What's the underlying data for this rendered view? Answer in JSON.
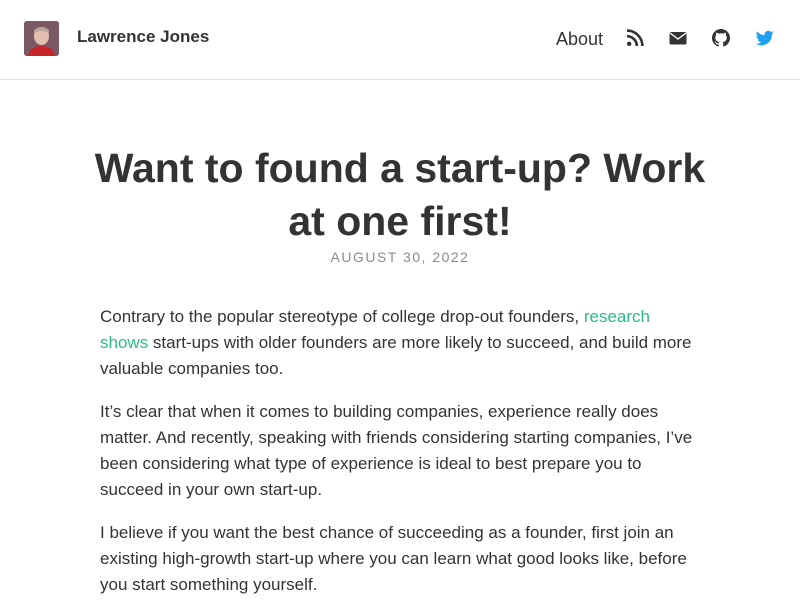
{
  "header": {
    "site_title": "Lawrence Jones",
    "nav": {
      "about_label": "About",
      "icons": [
        "rss-icon",
        "envelope-icon",
        "github-icon",
        "twitter-icon"
      ]
    }
  },
  "post": {
    "title": "Want to found a start-up? Work at one first!",
    "date": "AUGUST 30, 2022",
    "paragraphs": [
      {
        "before_link": "Contrary to the popular stereotype of college drop-out founders, ",
        "link_text": "research shows",
        "after_link": " start-ups with older founders are more likely to succeed, and build more valuable companies too."
      },
      {
        "text": "It’s clear that when it comes to building companies, experience really does matter. And recently, speaking with friends considering starting companies, I’ve been considering what type of experience is ideal to best prepare you to succeed in your own start-up."
      },
      {
        "text": "I believe if you want the best chance of succeeding as a founder, first join an existing high-growth start-up where you can learn what good looks like, before you start something yourself."
      }
    ]
  },
  "colors": {
    "link": "#2bbc8a",
    "twitter": "#1da1f2",
    "text": "#333333",
    "muted": "#8a8a8a"
  }
}
